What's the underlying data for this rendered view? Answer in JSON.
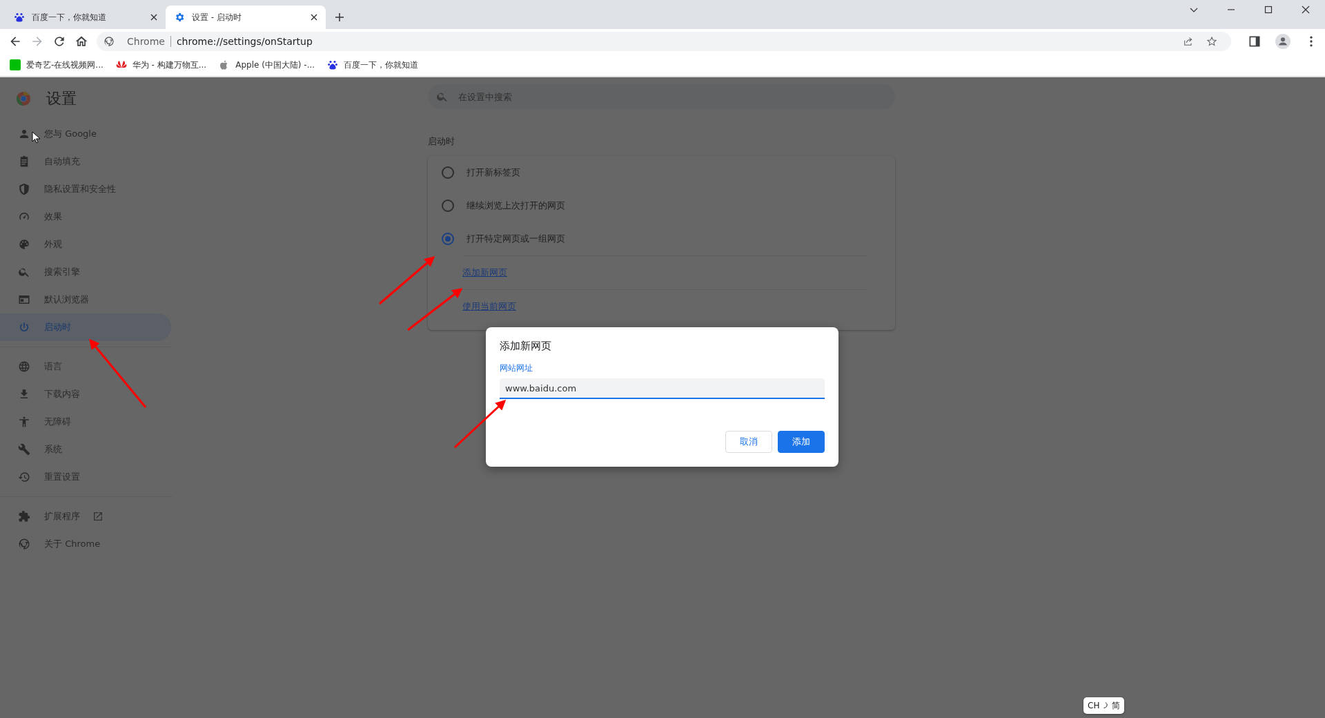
{
  "tabs": [
    {
      "title": "百度一下，你就知道",
      "selected": false
    },
    {
      "title": "设置 - 启动时",
      "selected": true
    }
  ],
  "nav_buttons": [
    {
      "kind": "back",
      "disabled": false
    },
    {
      "kind": "forward",
      "disabled": true
    },
    {
      "kind": "reload",
      "disabled": false
    },
    {
      "kind": "home",
      "disabled": false
    }
  ],
  "address_bar": {
    "site_label": "Chrome",
    "url": "chrome://settings/onStartup"
  },
  "bookmarks": [
    {
      "title": "爱奇艺-在线视频网..."
    },
    {
      "title": "华为 - 构建万物互..."
    },
    {
      "title": "Apple (中国大陆) -..."
    },
    {
      "title": "百度一下，你就知道"
    }
  ],
  "settings": {
    "title": "设置",
    "nav_groups": [
      [
        {
          "label": "您与 Google",
          "selected": false,
          "external": false
        },
        {
          "label": "自动填充",
          "selected": false,
          "external": false
        },
        {
          "label": "隐私设置和安全性",
          "selected": false,
          "external": false
        },
        {
          "label": "效果",
          "selected": false,
          "external": false
        },
        {
          "label": "外观",
          "selected": false,
          "external": false
        },
        {
          "label": "搜索引擎",
          "selected": false,
          "external": false
        },
        {
          "label": "默认浏览器",
          "selected": false,
          "external": false
        },
        {
          "label": "启动时",
          "selected": true,
          "external": false
        }
      ],
      [
        {
          "label": "语言",
          "selected": false,
          "external": false
        },
        {
          "label": "下载内容",
          "selected": false,
          "external": false
        },
        {
          "label": "无障碍",
          "selected": false,
          "external": false
        },
        {
          "label": "系统",
          "selected": false,
          "external": false
        },
        {
          "label": "重置设置",
          "selected": false,
          "external": false
        }
      ],
      [
        {
          "label": "扩展程序",
          "selected": false,
          "external": true
        },
        {
          "label": "关于 Chrome",
          "selected": false,
          "external": false
        }
      ]
    ],
    "search": {
      "placeholder": "在设置中搜索"
    },
    "section": {
      "title": "启动时",
      "options": [
        {
          "label": "打开新标签页",
          "selected": false
        },
        {
          "label": "继续浏览上次打开的网页",
          "selected": false
        },
        {
          "label": "打开特定网页或一组网页",
          "selected": true
        }
      ],
      "links": [
        "添加新网页",
        "使用当前网页"
      ]
    }
  },
  "dialog": {
    "title": "添加新网页",
    "field_label": "网站网址",
    "value": "www.baidu.com",
    "buttons": [
      {
        "label": "取消",
        "kind": "secondary"
      },
      {
        "label": "添加",
        "kind": "primary"
      }
    ]
  },
  "ime": {
    "language": "CH",
    "mode": "简"
  }
}
